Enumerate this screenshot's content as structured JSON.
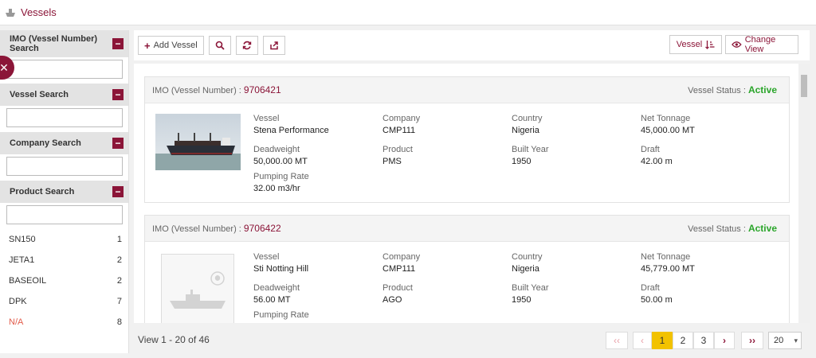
{
  "header": {
    "title": "Vessels"
  },
  "sidebar": {
    "sections": [
      {
        "title": "IMO (Vessel Number) Search",
        "value": ""
      },
      {
        "title": "Vessel Search",
        "value": ""
      },
      {
        "title": "Company Search",
        "value": ""
      },
      {
        "title": "Product Search",
        "value": ""
      }
    ],
    "facets": [
      {
        "label": "SN150",
        "count": "1"
      },
      {
        "label": "JETA1",
        "count": "2"
      },
      {
        "label": "BASEOIL",
        "count": "2"
      },
      {
        "label": "DPK",
        "count": "7"
      },
      {
        "label": "N/A",
        "count": "8"
      }
    ]
  },
  "toolbar": {
    "add_label": "Add Vessel",
    "sort_label": "Vessel",
    "change_view_label": "Change View"
  },
  "colors": {
    "accent": "#8b1538",
    "active": "#2aa52a",
    "current_page": "#f2c200"
  },
  "vessels": [
    {
      "imo_label": "IMO (Vessel Number) :",
      "imo": "9706421",
      "status_label": "Vessel Status :",
      "status": "Active",
      "has_photo": true,
      "fields": {
        "vessel": {
          "label": "Vessel",
          "value": "Stena Performance"
        },
        "company": {
          "label": "Company",
          "value": "CMP111"
        },
        "country": {
          "label": "Country",
          "value": "Nigeria"
        },
        "net_tonnage": {
          "label": "Net Tonnage",
          "value": "45,000.00 MT"
        },
        "deadweight": {
          "label": "Deadweight",
          "value": "50,000.00 MT"
        },
        "product": {
          "label": "Product",
          "value": "PMS"
        },
        "built_year": {
          "label": "Built Year",
          "value": "1950"
        },
        "draft": {
          "label": "Draft",
          "value": "42.00 m"
        },
        "pumping_rate": {
          "label": "Pumping Rate",
          "value": "32.00 m3/hr"
        }
      }
    },
    {
      "imo_label": "IMO (Vessel Number) :",
      "imo": "9706422",
      "status_label": "Vessel Status :",
      "status": "Active",
      "has_photo": false,
      "fields": {
        "vessel": {
          "label": "Vessel",
          "value": "Sti Notting Hill"
        },
        "company": {
          "label": "Company",
          "value": "CMP111"
        },
        "country": {
          "label": "Country",
          "value": "Nigeria"
        },
        "net_tonnage": {
          "label": "Net Tonnage",
          "value": "45,779.00 MT"
        },
        "deadweight": {
          "label": "Deadweight",
          "value": "56.00 MT"
        },
        "product": {
          "label": "Product",
          "value": "AGO"
        },
        "built_year": {
          "label": "Built Year",
          "value": "1950"
        },
        "draft": {
          "label": "Draft",
          "value": "50.00 m"
        },
        "pumping_rate": {
          "label": "Pumping Rate",
          "value": ""
        }
      }
    }
  ],
  "footer": {
    "view_text": "View 1 - 20 of 46",
    "first": "‹‹",
    "prev": "‹",
    "pages": [
      "1",
      "2",
      "3"
    ],
    "current_page": "1",
    "next": "›",
    "last": "››",
    "page_size": "20"
  }
}
